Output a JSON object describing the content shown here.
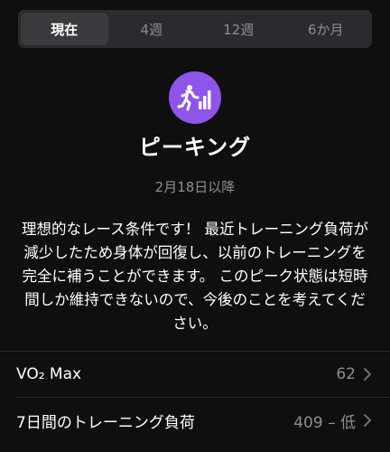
{
  "tabs": [
    "現在",
    "4週",
    "12週",
    "6か月"
  ],
  "status": {
    "title": "ピーキング",
    "since": "2月18日以降",
    "description": "理想的なレース条件です！ 最近トレーニング負荷が減少したため身体が回復し、以前のトレーニングを完全に補うことができます。 このピーク状態は短時間しか維持できないので、今後のことを考えてください。",
    "icon": "peaking-icon",
    "accent": "#8e55ea"
  },
  "rows": [
    {
      "label": "VO₂ Max",
      "value": "62"
    },
    {
      "label": "7日間のトレーニング負荷",
      "value": "409 – 低"
    }
  ]
}
